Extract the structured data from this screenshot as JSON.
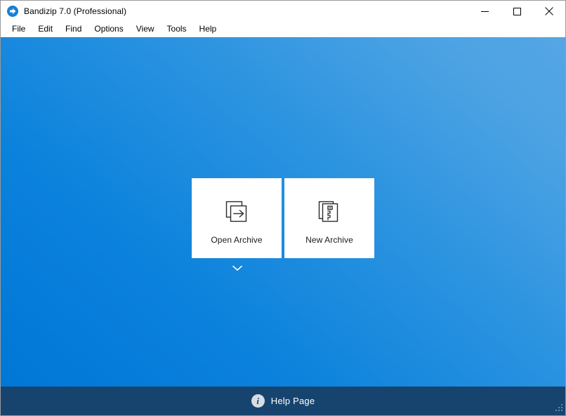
{
  "window": {
    "title": "Bandizip 7.0 (Professional)",
    "app_icon": "bandizip-logo-icon",
    "controls": [
      {
        "name": "minimize-button",
        "glyph": "minimize-icon"
      },
      {
        "name": "maximize-button",
        "glyph": "maximize-icon"
      },
      {
        "name": "close-button",
        "glyph": "close-icon"
      }
    ]
  },
  "menu": {
    "items": [
      {
        "label": "File"
      },
      {
        "label": "Edit"
      },
      {
        "label": "Find"
      },
      {
        "label": "Options"
      },
      {
        "label": "View"
      },
      {
        "label": "Tools"
      },
      {
        "label": "Help"
      }
    ]
  },
  "main": {
    "cards": [
      {
        "label": "Open Archive",
        "icon": "open-archive-icon"
      },
      {
        "label": "New Archive",
        "icon": "new-archive-icon"
      }
    ],
    "expand_icon": "chevron-down-icon"
  },
  "footer": {
    "help_label": "Help Page",
    "help_icon": "info-circle-icon",
    "resize_grip": "resize-grip-icon"
  },
  "colors": {
    "gradient_start": "#0077d6",
    "gradient_end": "#55a6e4",
    "footer_bg": "#16446f",
    "card_bg": "#ffffff",
    "title_bar_bg": "#ffffff",
    "icon_stroke": "#2b2b2b"
  }
}
